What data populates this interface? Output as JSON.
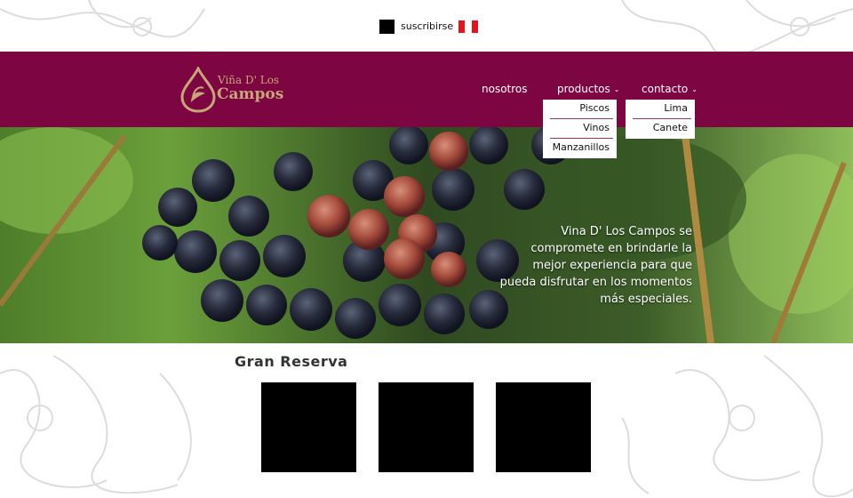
{
  "topbar": {
    "subscribe_label": "suscribirse",
    "flag_colors": [
      "#e4141e",
      "#ffffff",
      "#e4141e"
    ]
  },
  "brand": {
    "line1": "Viña D' Los",
    "line2": "Campos",
    "color": "#c7a779"
  },
  "header": {
    "bg_color": "#7d0541"
  },
  "nav": {
    "items": [
      {
        "label": "nosotros",
        "has_dropdown": false
      },
      {
        "label": "productos",
        "has_dropdown": true
      },
      {
        "label": "contacto",
        "has_dropdown": true
      }
    ],
    "products_menu": [
      "Piscos",
      "Vinos",
      "Manzanillos"
    ],
    "contact_menu": [
      "Lima",
      "Canete"
    ]
  },
  "hero": {
    "tagline": "Vina D' Los Campos se compromete en brindarle la mejor experiencia para que pueda disfrutar en los momentos más especiales."
  },
  "gran_reserva": {
    "title": "Gran Reserva",
    "product_count": 3
  }
}
